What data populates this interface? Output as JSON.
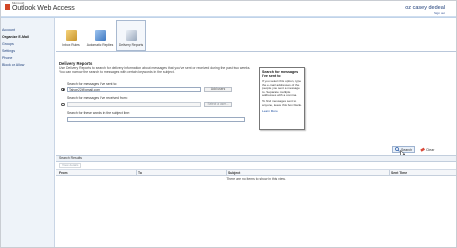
{
  "header": {
    "product_sub": "Microsoft",
    "product_title": "Outlook Web Access",
    "user_name": "oz casey dedeal",
    "sign_out": "Sign out"
  },
  "nav": {
    "items": [
      {
        "label": "Account"
      },
      {
        "label": "Organize E-Mail"
      },
      {
        "label": "Groups"
      },
      {
        "label": "Settings"
      },
      {
        "label": "Phone"
      },
      {
        "label": "Block or Allow"
      }
    ],
    "active_index": 1
  },
  "tabs": [
    {
      "label": "Inbox Rules"
    },
    {
      "label": "Automatic Replies"
    },
    {
      "label": "Delivery Reports"
    }
  ],
  "main": {
    "section_title": "Delivery Reports",
    "description": "Use Delivery Reports to search for delivery information about messages that you've sent or received during the past two weeks. You can narrow the search to messages with certain keywords in the subject.",
    "sent_to_label": "Search for messages I've sent to:",
    "sent_to_value": "Tahoe22@gmail.com",
    "add_users_button": "Add users",
    "received_from_label": "Search for messages I've received from:",
    "received_from_value": "",
    "select_user_button": "Select a user...",
    "subject_label": "Search for these words in the subject line:",
    "subject_value": ""
  },
  "help": {
    "title": "Search for messages I've sent to",
    "body": "If you select this option, type the e-mail addresses of the people you sent a message to. Separate multiple addresses with a comma.",
    "body2": "To find messages sent to anyone, leave this box blank.",
    "link": "Learn More"
  },
  "actions": {
    "search": "Search",
    "clear": "Clear"
  },
  "results": {
    "header": "Search Results",
    "view_details": "View details",
    "columns": [
      "From",
      "To",
      "Subject",
      "Sent Time"
    ],
    "empty_text": "There are no items to show in this view."
  }
}
